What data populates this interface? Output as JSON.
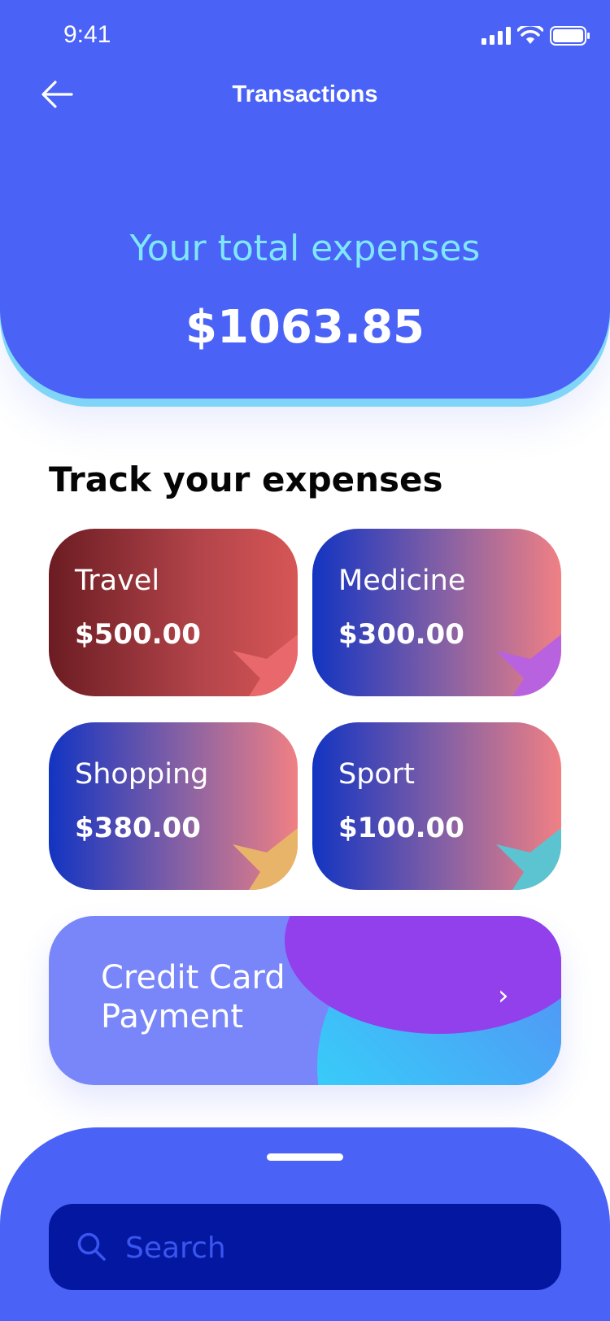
{
  "status_bar": {
    "time": "9:41"
  },
  "header": {
    "title": "Transactions",
    "total_label": "Your total expenses",
    "total_value": "$1063.85"
  },
  "section": {
    "title": "Track your expenses"
  },
  "categories": [
    {
      "name": "Travel",
      "amount": "$500.00"
    },
    {
      "name": "Medicine",
      "amount": "$300.00"
    },
    {
      "name": "Shopping",
      "amount": "$380.00"
    },
    {
      "name": "Sport",
      "amount": "$100.00"
    }
  ],
  "credit_card": {
    "label": "Credit Card\nPayment",
    "chevron": "›"
  },
  "search": {
    "placeholder": "Search"
  },
  "colors": {
    "primary": "#4A63F6",
    "accent": "#7FE7FF",
    "search_bg": "#0417A0"
  }
}
